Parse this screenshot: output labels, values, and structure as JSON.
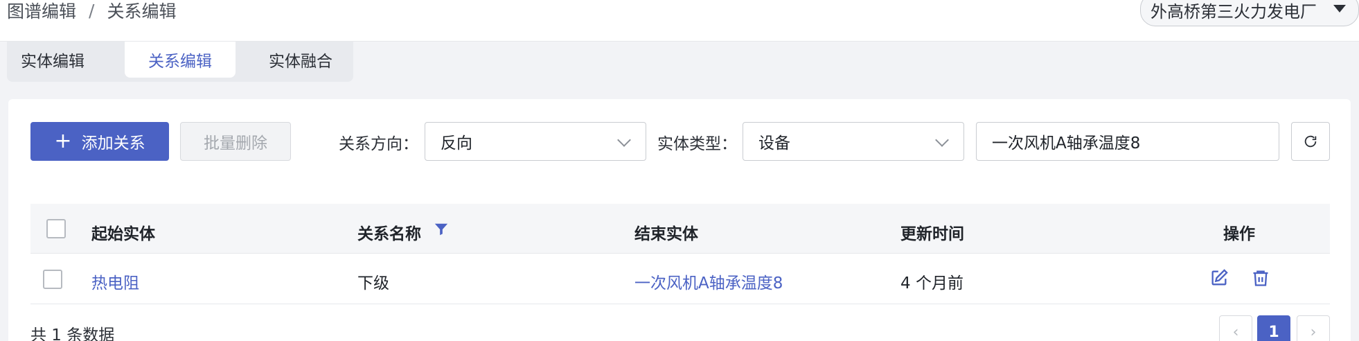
{
  "breadcrumb": {
    "parent": "图谱编辑",
    "separator": "/",
    "current": "关系编辑"
  },
  "plant_selector": {
    "value": "外高桥第三火力发电厂"
  },
  "tabs": [
    {
      "label": "实体编辑",
      "active": false
    },
    {
      "label": "关系编辑",
      "active": true
    },
    {
      "label": "实体融合",
      "active": false
    }
  ],
  "toolbar": {
    "add_label": "添加关系",
    "delete_label": "批量删除",
    "direction_label": "关系方向：",
    "direction_value": "反向",
    "entity_type_label": "实体类型：",
    "entity_type_value": "设备",
    "search_value": "一次风机A轴承温度8"
  },
  "table": {
    "headers": {
      "start_entity": "起始实体",
      "relation_name": "关系名称",
      "end_entity": "结束实体",
      "updated": "更新时间",
      "actions": "操作"
    },
    "rows": [
      {
        "start_entity": "热电阻",
        "relation_name": "下级",
        "end_entity": "一次风机A轴承温度8",
        "updated": "4 个月前"
      }
    ]
  },
  "footer": {
    "total_text": "共 1 条数据"
  },
  "pagination": {
    "prev_icon": "‹",
    "current_page": "1",
    "next_icon": "›"
  },
  "colors": {
    "accent": "#4b62c4",
    "background": "#f2f3f6"
  },
  "icons": {
    "add": "plus-icon",
    "refresh": "refresh-icon",
    "filter": "filter-icon",
    "edit": "edit-icon",
    "delete": "trash-icon",
    "dropdown": "chevron-down-icon"
  }
}
